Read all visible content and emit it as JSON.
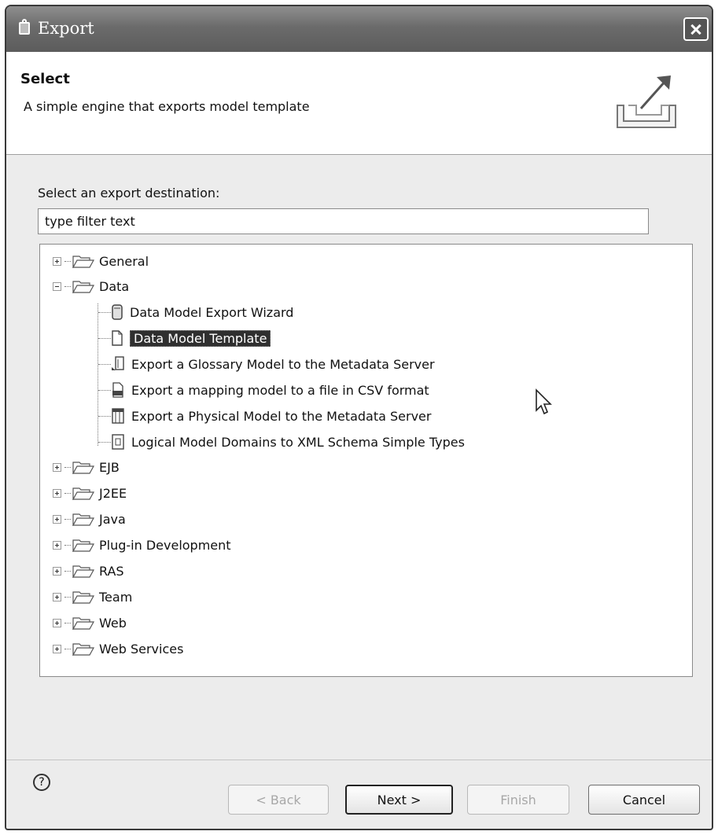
{
  "window": {
    "title": "Export"
  },
  "header": {
    "title": "Select",
    "description": "A simple engine that exports model template"
  },
  "destination_label": "Select an export destination:",
  "filter": {
    "placeholder": "type filter text"
  },
  "tree": {
    "general": "General",
    "data": "Data",
    "data_children": [
      "Data Model Export Wizard",
      "Data Model Template",
      "Export a Glossary Model to the Metadata Server",
      "Export a mapping model to a file in CSV format",
      "Export a Physical Model to the Metadata Server",
      "Logical Model Domains to XML Schema Simple Types"
    ],
    "others": [
      "EJB",
      "J2EE",
      "Java",
      "Plug-in Development",
      "RAS",
      "Team",
      "Web",
      "Web Services"
    ],
    "selected": "Data Model Template"
  },
  "buttons": {
    "help": "?",
    "back": "< Back",
    "next": "Next >",
    "finish": "Finish",
    "cancel": "Cancel"
  }
}
